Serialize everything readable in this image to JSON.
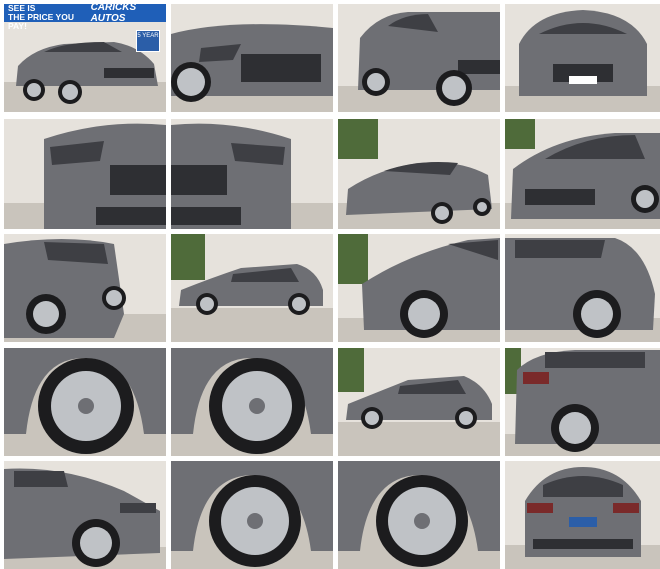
{
  "banner": {
    "slogan": "THE PRICE YOU SEE IS\nTHE PRICE YOU PAY!",
    "brand": "CARICKS AUTOS"
  },
  "badge": {
    "text": "5 YEAR"
  },
  "photos": [
    {
      "name": "photo-front-three-quarter"
    },
    {
      "name": "photo-front-bumper-closeup"
    },
    {
      "name": "photo-front-left-angle"
    },
    {
      "name": "photo-front-straight"
    },
    {
      "name": "photo-grille-left"
    },
    {
      "name": "photo-grille-right"
    },
    {
      "name": "photo-front-angle-trees"
    },
    {
      "name": "photo-front-right-angle"
    },
    {
      "name": "photo-rear-three-quarter-left"
    },
    {
      "name": "photo-side-profile"
    },
    {
      "name": "photo-front-wheel-right"
    },
    {
      "name": "photo-rear-quarter-right"
    },
    {
      "name": "photo-wheel-closeup-1"
    },
    {
      "name": "photo-wheel-closeup-2"
    },
    {
      "name": "photo-side-profile-2"
    },
    {
      "name": "photo-rear-wheel-closeup"
    },
    {
      "name": "photo-front-wheel-left"
    },
    {
      "name": "photo-wheel-closeup-3"
    },
    {
      "name": "photo-wheel-closeup-4"
    },
    {
      "name": "photo-rear-straight"
    }
  ],
  "colors": {
    "car_body": "#6e6f74",
    "car_dark": "#3e3f44",
    "ground": "#c9c4bc",
    "wall": "#e6e2dc",
    "tire": "#1c1c1e",
    "rim": "#bfc2c6",
    "foliage": "#4f6b3a"
  }
}
